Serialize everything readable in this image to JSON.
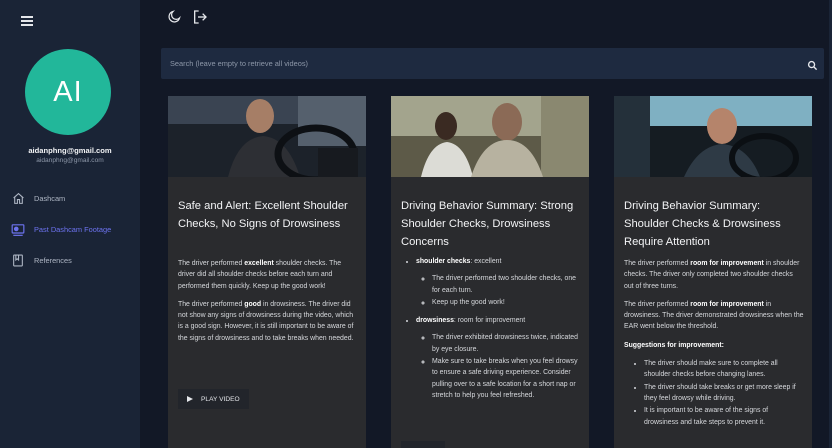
{
  "sidebar": {
    "avatar_initials": "AI",
    "user_name": "aidanphng@gmail.com",
    "user_email": "aidanphng@gmail.com",
    "nav": [
      {
        "label": "Dashcam",
        "icon": "home-icon"
      },
      {
        "label": "Past Dashcam Footage",
        "icon": "video-recording-icon",
        "active": true
      },
      {
        "label": "References",
        "icon": "bookmark-book-icon"
      }
    ]
  },
  "topbar": {
    "theme_icon": "moon-icon",
    "logout_icon": "logout-icon"
  },
  "search": {
    "placeholder": "Search (leave empty to retrieve all videos)",
    "value": ""
  },
  "cards": [
    {
      "title": "Safe and Alert: Excellent Shoulder Checks, No Signs of Drowsiness",
      "paragraphs": [
        {
          "pre": "The driver performed ",
          "bold": "excellent",
          "post": " shoulder checks. The driver did all shoulder checks before each turn and performed them quickly. Keep up the good work!"
        },
        {
          "pre": "The driver performed ",
          "bold": "good",
          "post": " in drowsiness. The driver did not show any signs of drowsiness during the video, which is a good sign. However, it is still important to be aware of the signs of drowsiness and to take breaks when needed."
        }
      ],
      "play_label": "PLAY VIDEO"
    },
    {
      "title": "Driving Behavior Summary: Strong Shoulder Checks, Drowsiness Concerns",
      "bullets": [
        {
          "bold": "shoulder checks",
          "text": ": excellent",
          "sub": [
            "The driver performed two shoulder checks, one for each turn.",
            "Keep up the good work!"
          ]
        },
        {
          "bold": "drowsiness",
          "text": ": room for improvement",
          "sub": [
            "The driver exhibited drowsiness twice, indicated by eye closure.",
            "Make sure to take breaks when you feel drowsy to ensure a safe driving experience. Consider pulling over to a safe location for a short nap or stretch to help you feel refreshed."
          ]
        }
      ]
    },
    {
      "title": "Driving Behavior Summary: Shoulder Checks & Drowsiness Require Attention",
      "paragraphs": [
        {
          "pre": "The driver performed ",
          "bold": "room for improvement",
          "post": " in shoulder checks. The driver only completed two shoulder checks out of three turns."
        },
        {
          "pre": "The driver performed ",
          "bold": "room for improvement",
          "post": " in drowsiness. The driver demonstrated drowsiness when the EAR went below the threshold."
        }
      ],
      "suggestions_label": "Suggestions for improvement:",
      "suggestions": [
        "The driver should make sure to complete all shoulder checks before changing lanes.",
        "The driver should take breaks or get more sleep if they feel drowsy while driving.",
        "It is important to be aware of the signs of drowsiness and take steps to prevent it."
      ]
    }
  ],
  "colors": {
    "background": "#121826",
    "sidebar": "#1a2436",
    "card": "#2a2b2e",
    "accent": "#6d73f0",
    "avatar": "#22b79a"
  }
}
